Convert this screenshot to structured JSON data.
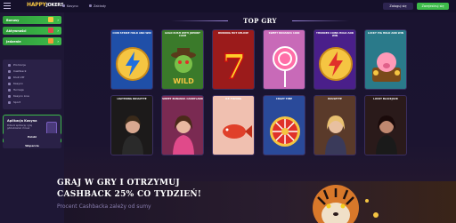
{
  "header": {
    "logo_main": "HAPPY",
    "logo_accent": "JOKERS",
    "tabs": [
      "Kasyno",
      "Zakłady"
    ],
    "login_label": "Zaloguj się",
    "register_label": "Zarejestruj się"
  },
  "sidebar": {
    "main_items": [
      {
        "label": "Bonusy",
        "color": "#3dbb4a"
      },
      {
        "label": "Aktywności",
        "color": "#3dbb4a"
      },
      {
        "label": "Jedzenie",
        "color": "#3dbb4a"
      }
    ],
    "sub_items": [
      "Promocje",
      "Cashback",
      "Klub VIP",
      "Kasyno",
      "Turnieje",
      "Kasyno Live",
      "Sport"
    ],
    "app": {
      "title": "Aplikacja Kasyna",
      "subtitle": "Pobierz aplikację i graj gdziekolwiek chcesz",
      "button": "Pobierz"
    },
    "language": "Polski",
    "support": "Wsparcie"
  },
  "main": {
    "section_title": "TOP GRY",
    "games_row1": [
      {
        "title": "COIN STRIKE HOLD AND WIN",
        "bg": "#1f4fa8"
      },
      {
        "title": "GOLD RUSH WITH JOHNNY CASH",
        "bg": "#3a7a2a"
      },
      {
        "title": "BURNING HOT DELUXE",
        "bg": "#9b1b1b"
      },
      {
        "title": "SWEET BONANZA 1000",
        "bg": "#c86ab8"
      },
      {
        "title": "THUNDER COINS HOLD AND WIN",
        "bg": "#4a1f8a"
      },
      {
        "title": "LUCKY PIG HOLD AND WIN",
        "bg": "#2a7a8a"
      }
    ],
    "games_row2": [
      {
        "title": "LIGHTNING ROULETTE",
        "bg": "#1c1a1a"
      },
      {
        "title": "SWEET BONANZA CANDYLAND",
        "bg": "#7a2a52"
      },
      {
        "title": "ICE FISHING",
        "bg": "#f0c0b0"
      },
      {
        "title": "CRAZY TIME",
        "bg": "#2a4a9a"
      },
      {
        "title": "ROULETTE",
        "bg": "#5a3a2a"
      },
      {
        "title": "LUCKY BLACKJACK",
        "bg": "#2a1a1a"
      }
    ],
    "banner": {
      "line1": "GRAJ W GRY I OTRZYMUJ",
      "line2": "CASHBACK 25% CO TYDZIEŃ!",
      "line3": "Procent Cashbacka zależy od sumy"
    }
  }
}
